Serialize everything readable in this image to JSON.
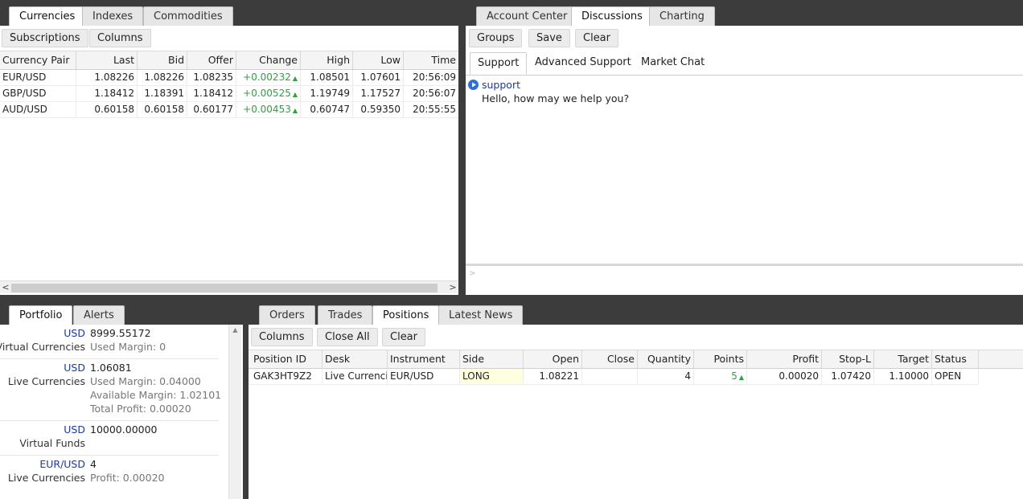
{
  "currencies_panel": {
    "tabs": [
      "Currencies",
      "Indexes",
      "Commodities"
    ],
    "toolbar": {
      "subscriptions": "Subscriptions",
      "columns": "Columns"
    },
    "columns": [
      "Currency Pair",
      "Last",
      "Bid",
      "Offer",
      "Change",
      "High",
      "Low",
      "Time"
    ],
    "rows": [
      {
        "pair": "EUR/USD",
        "last": "1.08226",
        "bid": "1.08226",
        "offer": "1.08235",
        "change": "+0.00232",
        "high": "1.08501",
        "low": "1.07601",
        "time": "20:56:09"
      },
      {
        "pair": "GBP/USD",
        "last": "1.18412",
        "bid": "1.18391",
        "offer": "1.18412",
        "change": "+0.00525",
        "high": "1.19749",
        "low": "1.17527",
        "time": "20:56:07"
      },
      {
        "pair": "AUD/USD",
        "last": "0.60158",
        "bid": "0.60158",
        "offer": "0.60177",
        "change": "+0.00453",
        "high": "0.60747",
        "low": "0.59350",
        "time": "20:55:55"
      }
    ],
    "up_arrow": "▲",
    "scroll_left": "<",
    "scroll_right": ">"
  },
  "discussions_panel": {
    "tabs": [
      "Account Center",
      "Discussions",
      "Charting"
    ],
    "toolbar": {
      "groups": "Groups",
      "save": "Save",
      "clear": "Clear"
    },
    "subtabs": [
      "Support",
      "Advanced Support",
      "Market Chat"
    ],
    "message": {
      "sender": "support",
      "text": "Hello, how may we help you?"
    },
    "input_prompt": ">"
  },
  "portfolio_panel": {
    "tabs": [
      "Portfolio",
      "Alerts"
    ],
    "items": [
      {
        "currency": "USD",
        "amount": "8999.55172",
        "label": "Virtual Currencies",
        "details": [
          "Used Margin:  0"
        ]
      },
      {
        "currency": "USD",
        "amount": "1.06081",
        "label": "Live Currencies",
        "details": [
          "Used Margin:  0.04000",
          "Available Margin:  1.02101",
          "Total Profit:  0.00020"
        ]
      },
      {
        "currency": "USD",
        "amount": "10000.00000",
        "label": "Virtual Funds",
        "details": []
      },
      {
        "currency": "EUR/USD",
        "amount": "4",
        "label": "Live Currencies",
        "details": [
          "Profit:  0.00020"
        ]
      }
    ],
    "scroll_up": "▲"
  },
  "positions_panel": {
    "tabs": [
      "Orders",
      "Trades",
      "Positions",
      "Latest News"
    ],
    "toolbar": {
      "columns": "Columns",
      "close_all": "Close All",
      "clear": "Clear"
    },
    "columns": [
      "Position ID",
      "Desk",
      "Instrument",
      "Side",
      "Open",
      "Close",
      "Quantity",
      "Points",
      "Profit",
      "Stop-L",
      "Target",
      "Status"
    ],
    "rows": [
      {
        "id": "GAK3HT9Z2",
        "desk": "Live Currencies",
        "instrument": "EUR/USD",
        "side": "LONG",
        "open": "1.08221",
        "close": "",
        "quantity": "4",
        "points": "5",
        "profit": "0.00020",
        "stop": "1.07420",
        "target": "1.10000",
        "status": "OPEN"
      }
    ]
  },
  "colors": {
    "background": "#3c3c3c",
    "positive": "#2ea043",
    "side_highlight": "#ffffe0",
    "currency_blue": "#1a3a9a"
  }
}
